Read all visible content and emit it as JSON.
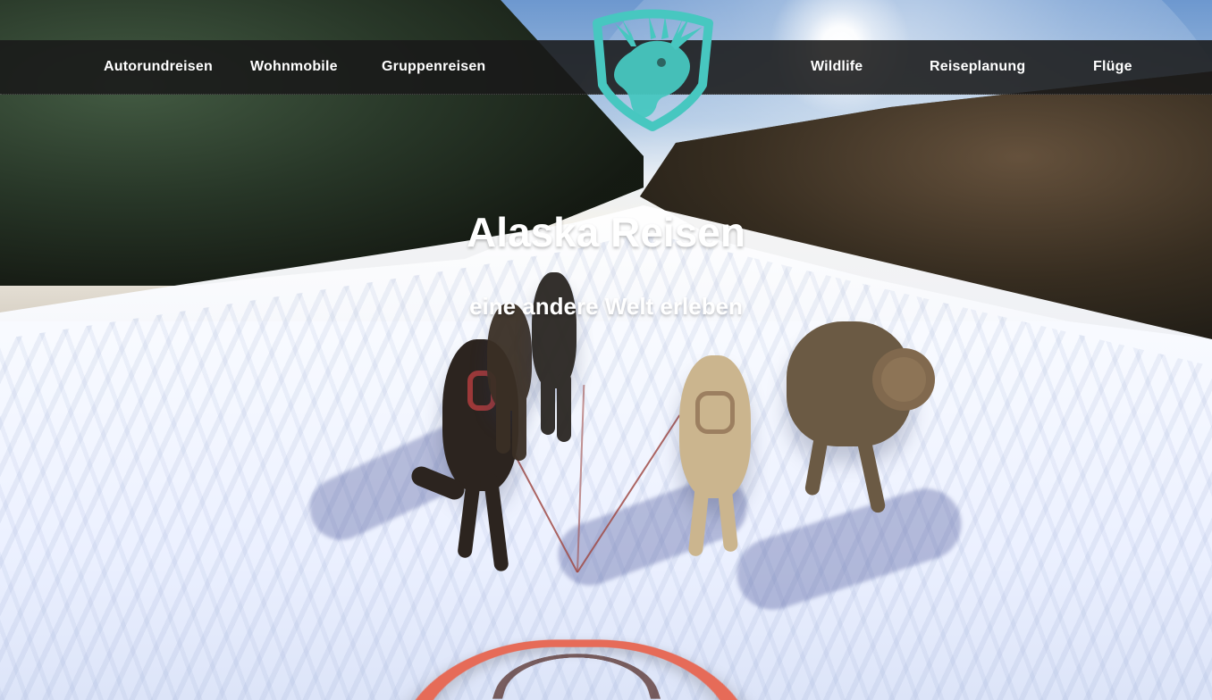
{
  "nav": {
    "left": [
      {
        "label": "Autorundreisen"
      },
      {
        "label": "Wohnmobile"
      },
      {
        "label": "Gruppenreisen"
      }
    ],
    "right": [
      {
        "label": "Wildlife"
      },
      {
        "label": "Reiseplanung"
      },
      {
        "label": "Flüge"
      }
    ]
  },
  "logo": {
    "icon": "moose-logo-icon"
  },
  "hero": {
    "title": "Alaska Reisen",
    "subtitle": "eine andere Welt erleben"
  },
  "colors": {
    "accent": "#47c7c0",
    "navbar_bg": "#191919",
    "nav_text": "#ffffff"
  }
}
